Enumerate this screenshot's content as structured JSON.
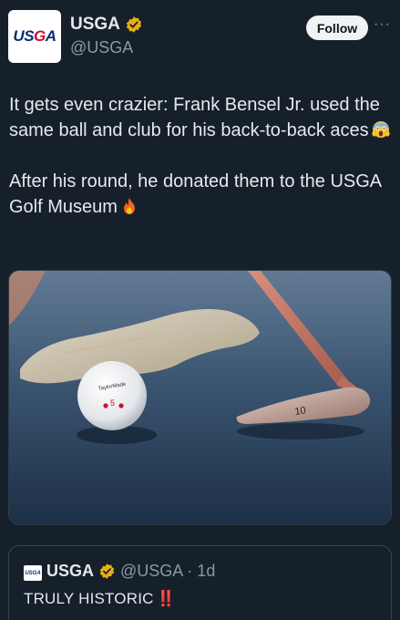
{
  "account": {
    "display_name": "USGA",
    "handle": "@USGA",
    "avatar_text": "USGA",
    "verified_color": "#e8b00f"
  },
  "header": {
    "follow_label": "Follow",
    "more_label": "···"
  },
  "tweet": {
    "line1": "It gets even crazier: Frank Bensel Jr. used the same ball and club for his back-to-back aces",
    "line2": "After his round, he donated them to the USGA Golf Museum",
    "emoji1": "face-screaming-icon",
    "emoji2": "fire-icon"
  },
  "media": {
    "ball_brand": "TaylorMade",
    "ball_number": "5",
    "club_label": "10"
  },
  "quoted": {
    "display_name": "USGA",
    "handle_time": "@USGA · 1d",
    "text": "TRULY HISTORIC",
    "bang": "‼️",
    "avatar_text": "USGA"
  },
  "colors": {
    "background": "#15202b",
    "text": "#e7e9ea",
    "secondary": "#8b98a5",
    "follow_bg": "#eff3f4"
  }
}
